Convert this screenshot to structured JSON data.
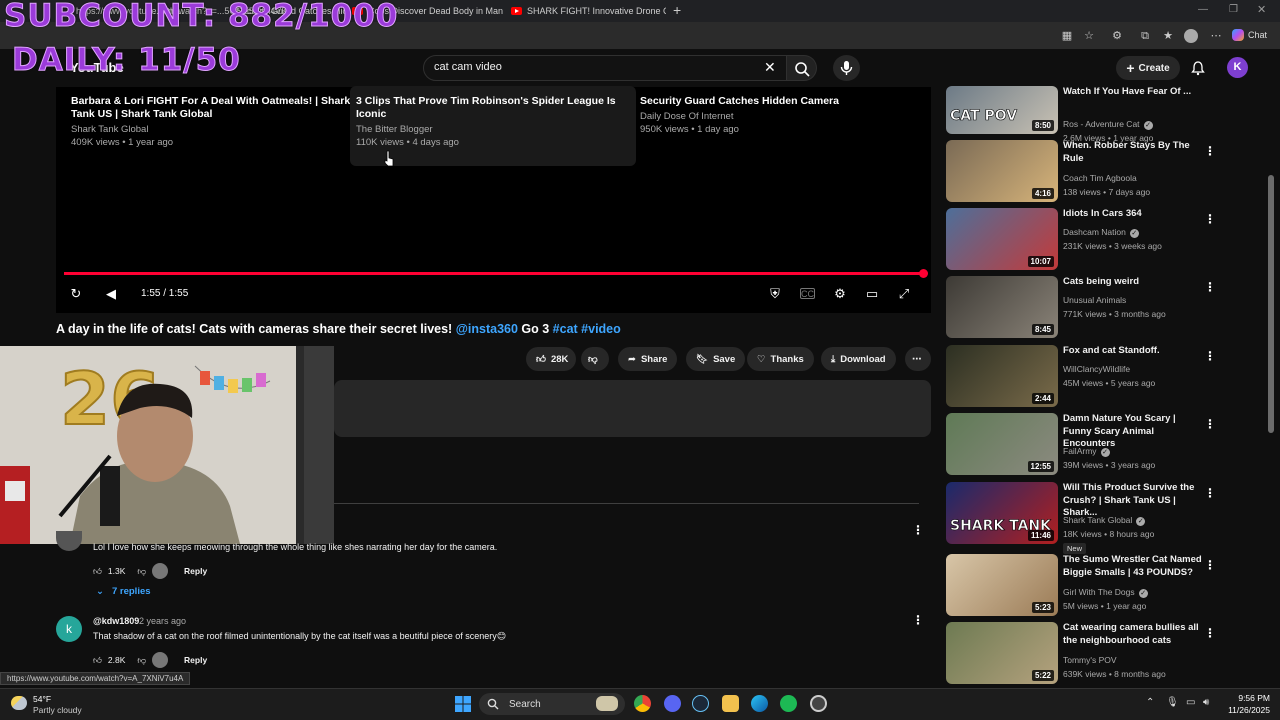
{
  "browser": {
    "tabs": [
      {
        "label": "…with…"
      },
      {
        "label": "Security Guard Catches Hidden Ca"
      },
      {
        "label": "Cops Discover Dead Body in Man"
      },
      {
        "label": "SHARK FIGHT! Innovative Drone C"
      }
    ],
    "new_tab_glyph": "+",
    "url": "https://www.youtube.com/watch?v=...5ONE5Gvh4VE"
  },
  "overlay": {
    "line1": "SUBCOUNT: 882/1000",
    "line2": "DAILY: 11/50",
    "color": "#9b3bd9"
  },
  "youtube": {
    "logo_text": "YouTube",
    "search_value": "cat cam video",
    "create_label": "Create",
    "avatar_letter": "K"
  },
  "end_screen": [
    {
      "title": "Barbara & Lori FIGHT For A Deal With Oatmeals! | Shark Tank US | Shark Tank Global",
      "channel": "Shark Tank Global",
      "meta": "409K views • 1 year ago"
    },
    {
      "title": "3 Clips That Prove Tim Robinson's Spider League Is Iconic",
      "channel": "The Bitter Blogger",
      "meta": "110K views • 4 days ago"
    },
    {
      "title": "Security Guard Catches Hidden Camera",
      "channel": "Daily Dose Of Internet",
      "meta": "950K views • 1 day ago"
    }
  ],
  "player": {
    "timecode": "1:55 / 1:55",
    "progress": 1.0,
    "accent": "#ff0033"
  },
  "video": {
    "title_plain": "A day in the life of cats! Cats with cameras share their secret lives! ",
    "title_mention": "@insta360",
    "title_mid": " Go 3 ",
    "title_tags": "#cat #video"
  },
  "actions": {
    "likes": "28K",
    "share": "Share",
    "save": "Save",
    "thanks": "Thanks",
    "download": "Download"
  },
  "comments": [
    {
      "author": "",
      "time": "",
      "text": "Lol I love how she keeps meowing through the whole thing like shes narrating her day for the camera.",
      "likes": "1.3K",
      "reply": "Reply",
      "replies": "7 replies"
    },
    {
      "author": "@kdw1809",
      "time": "2 years ago",
      "text": "That shadow of a cat on the roof filmed unintentionally by the cat itself was a beutiful piece of scenery😊",
      "likes": "2.8K",
      "reply": "Reply"
    }
  ],
  "recommendations": [
    {
      "title": "Watch If You Have Fear Of ...",
      "channel": "Ros - Adventure Cat",
      "verified": true,
      "meta": "2.6M views • 1 year ago",
      "duration": "8:50",
      "thumb_text": "CAT POV",
      "thumb_colors": [
        "#6c7a86",
        "#c9c2b4"
      ]
    },
    {
      "title": "When. Robber Stays By The Rule",
      "channel": "Coach Tim Agboola",
      "verified": false,
      "meta": "138 views • 7 days ago",
      "duration": "4:16",
      "thumb_text": "",
      "thumb_colors": [
        "#7a6a55",
        "#d7b47a"
      ]
    },
    {
      "title": "Idiots In Cars 364",
      "channel": "Dashcam Nation",
      "verified": true,
      "meta": "231K views • 3 weeks ago",
      "duration": "10:07",
      "thumb_text": "",
      "thumb_colors": [
        "#4d6f9a",
        "#c43a3a"
      ]
    },
    {
      "title": "Cats being weird",
      "channel": "Unusual Animals",
      "verified": false,
      "meta": "771K views • 3 months ago",
      "duration": "8:45",
      "thumb_text": "",
      "thumb_colors": [
        "#3d3a35",
        "#8a8378"
      ]
    },
    {
      "title": "Fox and cat Standoff.",
      "channel": "WillClancyWildlife",
      "verified": false,
      "meta": "45M views • 5 years ago",
      "duration": "2:44",
      "thumb_text": "",
      "thumb_colors": [
        "#2c2f22",
        "#7a6b4a"
      ]
    },
    {
      "title": "Damn Nature You Scary | Funny Scary Animal Encounters",
      "channel": "FailArmy",
      "verified": true,
      "meta": "39M views • 3 years ago",
      "duration": "12:55",
      "thumb_text": "",
      "thumb_colors": [
        "#5f7a56",
        "#8c8a80"
      ]
    },
    {
      "title": "Will This Product Survive the Crush? | Shark Tank US | Shark...",
      "channel": "Shark Tank Global",
      "verified": true,
      "meta": "18K views • 8 hours ago",
      "duration": "11:46",
      "thumb_text": "SHARK TANK",
      "badge": "New",
      "thumb_colors": [
        "#1a2a6c",
        "#b21f1f"
      ]
    },
    {
      "title": "The Sumo Wrestler Cat Named Biggie Smalls | 43 POUNDS?",
      "channel": "Girl With The Dogs",
      "verified": true,
      "meta": "5M views • 1 year ago",
      "duration": "5:23",
      "thumb_text": "",
      "thumb_colors": [
        "#d8c6a8",
        "#9b7b56"
      ]
    },
    {
      "title": "Cat wearing camera bullies all the neighbourhood cats",
      "channel": "Tommy's POV",
      "verified": false,
      "meta": "639K views • 8 months ago",
      "duration": "5:22",
      "thumb_text": "",
      "thumb_colors": [
        "#6d7a52",
        "#b5a27e"
      ]
    }
  ],
  "status_link": "https://www.youtube.com/watch?v=A_7XNiV7u4A",
  "taskbar": {
    "temp": "54°F",
    "weather": "Partly cloudy",
    "search_label": "Search",
    "time": "9:56 PM",
    "date": "11/26/2025"
  }
}
